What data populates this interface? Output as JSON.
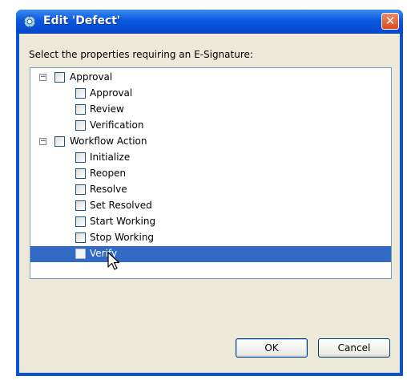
{
  "window": {
    "title": "Edit 'Defect'",
    "close_glyph": "✕"
  },
  "prompt": "Select the properties requiring an E-Signature:",
  "tree": {
    "groups": [
      {
        "label": "Approval",
        "expander": "−",
        "items": [
          "Approval",
          "Review",
          "Verification"
        ]
      },
      {
        "label": "Workflow Action",
        "expander": "−",
        "items": [
          "Initialize",
          "Reopen",
          "Resolve",
          "Set Resolved",
          "Start Working",
          "Stop Working",
          "Verify"
        ]
      }
    ],
    "selected_item": "Verify"
  },
  "buttons": {
    "ok": "OK",
    "cancel": "Cancel"
  },
  "icons": {
    "title_icon": "gear-icon",
    "cursor": "mouse-pointer-icon"
  },
  "colors": {
    "title_bar": "#0a58e0",
    "selection": "#316ac5",
    "dialog_bg": "#ece9d8"
  }
}
